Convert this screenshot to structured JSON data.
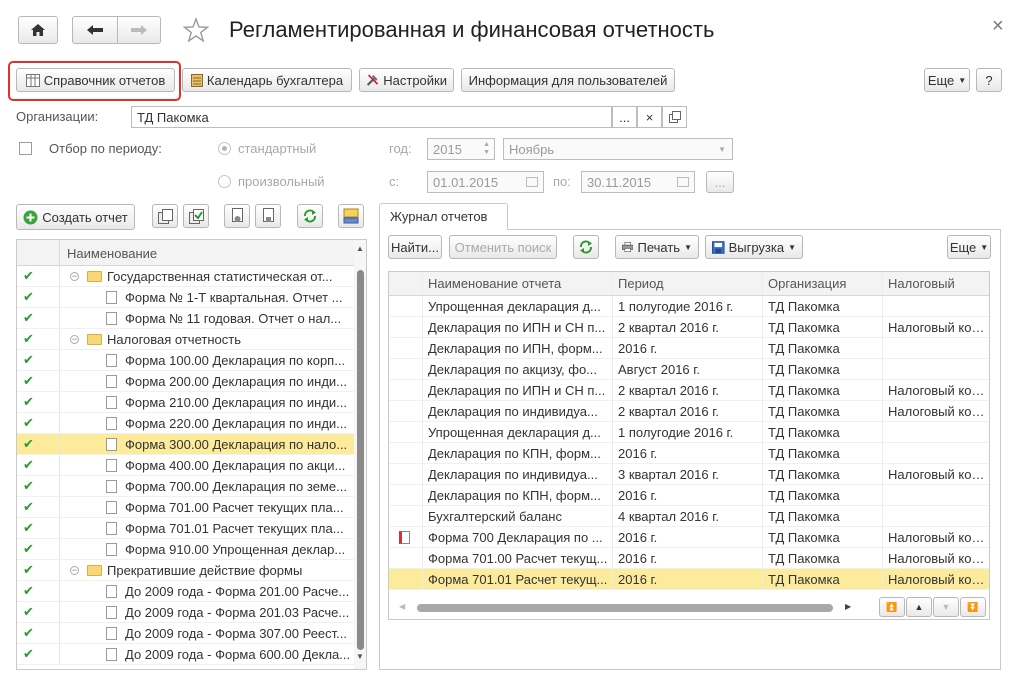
{
  "window": {
    "title": "Регламентированная и финансовая отчетность",
    "close_glyph": "×"
  },
  "toolbar": {
    "reports_catalog": "Справочник отчетов",
    "accountant_calendar": "Календарь бухгалтера",
    "settings": "Настройки",
    "user_info": "Информация для пользователей",
    "more": "Еще",
    "help": "?"
  },
  "filters": {
    "organization_label": "Организации:",
    "organization_value": "ТД Пакомка",
    "period_filter_label": "Отбор по периоду:",
    "standard_label": "стандартный",
    "custom_label": "произвольный",
    "year_label": "год:",
    "year_value": "2015",
    "month_value": "Ноябрь",
    "from_label": "с:",
    "from_value": "01.01.2015",
    "to_label": "по:",
    "to_value": "30.11.2015",
    "ellipsis": "...",
    "clear": "×"
  },
  "left_toolbar": {
    "create_report": "Создать отчет"
  },
  "tree": {
    "header": "Наименование",
    "rows": [
      {
        "level": 0,
        "type": "folder",
        "text": "Государственная статистическая от...",
        "selected": false
      },
      {
        "level": 1,
        "type": "doc",
        "text": "Форма № 1-Т квартальная. Отчет ...",
        "selected": false
      },
      {
        "level": 1,
        "type": "doc",
        "text": "Форма № 11 годовая. Отчет о нал...",
        "selected": false
      },
      {
        "level": 0,
        "type": "folder",
        "text": "Налоговая отчетность",
        "selected": false
      },
      {
        "level": 1,
        "type": "doc",
        "text": "Форма 100.00 Декларация по корп...",
        "selected": false
      },
      {
        "level": 1,
        "type": "doc",
        "text": "Форма 200.00 Декларация по инди...",
        "selected": false
      },
      {
        "level": 1,
        "type": "doc",
        "text": "Форма 210.00 Декларация по инди...",
        "selected": false
      },
      {
        "level": 1,
        "type": "doc",
        "text": "Форма 220.00 Декларация по инди...",
        "selected": false
      },
      {
        "level": 1,
        "type": "doc",
        "text": "Форма 300.00 Декларация по нало...",
        "selected": true
      },
      {
        "level": 1,
        "type": "doc",
        "text": "Форма 400.00 Декларация по акци...",
        "selected": false
      },
      {
        "level": 1,
        "type": "doc",
        "text": "Форма 700.00 Декларация по земе...",
        "selected": false
      },
      {
        "level": 1,
        "type": "doc",
        "text": "Форма 701.00 Расчет текущих пла...",
        "selected": false
      },
      {
        "level": 1,
        "type": "doc",
        "text": "Форма 701.01 Расчет текущих пла...",
        "selected": false
      },
      {
        "level": 1,
        "type": "doc",
        "text": "Форма 910.00 Упрощенная деклар...",
        "selected": false
      },
      {
        "level": 0,
        "type": "folder",
        "text": "Прекратившие действие формы",
        "selected": false
      },
      {
        "level": 1,
        "type": "doc",
        "text": "До 2009 года - Форма 201.00 Расче...",
        "selected": false
      },
      {
        "level": 1,
        "type": "doc",
        "text": "До 2009 года - Форма 201.03 Расче...",
        "selected": false
      },
      {
        "level": 1,
        "type": "doc",
        "text": "До 2009 года - Форма 307.00 Реест...",
        "selected": false
      },
      {
        "level": 1,
        "type": "doc",
        "text": "До 2009 года - Форма 600.00 Декла...",
        "selected": false
      }
    ]
  },
  "journal": {
    "tab_label": "Журнал отчетов",
    "find": "Найти...",
    "cancel_search": "Отменить поиск",
    "print": "Печать",
    "export": "Выгрузка",
    "more": "Еще",
    "columns": [
      "Наименование отчета",
      "Период",
      "Организация",
      "Налоговый ком..."
    ],
    "rows": [
      {
        "icon": false,
        "name": "Упрощенная декларация д...",
        "period": "1 полугодие 2016 г.",
        "org": "ТД Пакомка",
        "tax": "",
        "selected": false
      },
      {
        "icon": false,
        "name": "Декларация по ИПН и СН п...",
        "period": "2 квартал 2016 г.",
        "org": "ТД Пакомка",
        "tax": "Налоговый ком...",
        "selected": false
      },
      {
        "icon": false,
        "name": "Декларация по ИПН, форм...",
        "period": "2016 г.",
        "org": "ТД Пакомка",
        "tax": "",
        "selected": false
      },
      {
        "icon": false,
        "name": "Декларация по акцизу, фо...",
        "period": "Август 2016 г.",
        "org": "ТД Пакомка",
        "tax": "",
        "selected": false
      },
      {
        "icon": false,
        "name": "Декларация по ИПН и СН п...",
        "period": "2 квартал 2016 г.",
        "org": "ТД Пакомка",
        "tax": "Налоговый ком...",
        "selected": false
      },
      {
        "icon": false,
        "name": "Декларация по индивидуа...",
        "period": "2 квартал 2016 г.",
        "org": "ТД Пакомка",
        "tax": "Налоговый ком...",
        "selected": false
      },
      {
        "icon": false,
        "name": "Упрощенная декларация д...",
        "period": "1 полугодие 2016 г.",
        "org": "ТД Пакомка",
        "tax": "",
        "selected": false
      },
      {
        "icon": false,
        "name": "Декларация по КПН, форм...",
        "period": "2016 г.",
        "org": "ТД Пакомка",
        "tax": "",
        "selected": false
      },
      {
        "icon": false,
        "name": "Декларация по индивидуа...",
        "period": "3 квартал 2016 г.",
        "org": "ТД Пакомка",
        "tax": "Налоговый ком...",
        "selected": false
      },
      {
        "icon": false,
        "name": "Декларация по КПН, форм...",
        "period": "2016 г.",
        "org": "ТД Пакомка",
        "tax": "",
        "selected": false
      },
      {
        "icon": false,
        "name": "Бухгалтерский баланс",
        "period": "4 квартал 2016 г.",
        "org": "ТД Пакомка",
        "tax": "",
        "selected": false
      },
      {
        "icon": true,
        "name": "Форма 700 Декларация по ...",
        "period": "2016 г.",
        "org": "ТД Пакомка",
        "tax": "Налоговый ком...",
        "selected": false
      },
      {
        "icon": false,
        "name": "Форма 701.00 Расчет текущ...",
        "period": "2016 г.",
        "org": "ТД Пакомка",
        "tax": "Налоговый ком...",
        "selected": false
      },
      {
        "icon": false,
        "name": "Форма 701.01 Расчет текущ...",
        "period": "2016 г.",
        "org": "ТД Пакомка",
        "tax": "Налоговый ком...",
        "selected": true
      }
    ]
  },
  "colors": {
    "selection": "#fbeb9a",
    "highlight_border": "#e03030",
    "check_green": "#2a9a2a"
  }
}
